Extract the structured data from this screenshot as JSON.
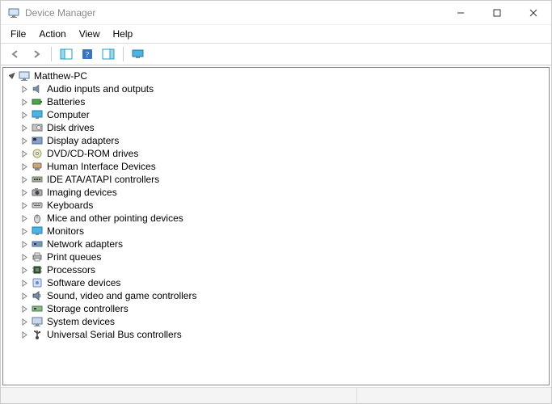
{
  "window": {
    "title": "Device Manager"
  },
  "menubar": {
    "items": [
      "File",
      "Action",
      "View",
      "Help"
    ]
  },
  "toolbar": {
    "back": "Back",
    "forward": "Forward",
    "show_hide": "Show/Hide Console Tree",
    "help": "Help",
    "action_pane": "Action Pane",
    "monitor": "Scan for hardware changes"
  },
  "tree": {
    "root": {
      "label": "Matthew-PC",
      "icon": "computer-icon",
      "expanded": true
    },
    "categories": [
      {
        "label": "Audio inputs and outputs",
        "icon": "speaker-icon"
      },
      {
        "label": "Batteries",
        "icon": "battery-icon"
      },
      {
        "label": "Computer",
        "icon": "monitor-icon"
      },
      {
        "label": "Disk drives",
        "icon": "disk-icon"
      },
      {
        "label": "Display adapters",
        "icon": "display-adapter-icon"
      },
      {
        "label": "DVD/CD-ROM drives",
        "icon": "dvd-icon"
      },
      {
        "label": "Human Interface Devices",
        "icon": "hid-icon"
      },
      {
        "label": "IDE ATA/ATAPI controllers",
        "icon": "ide-icon"
      },
      {
        "label": "Imaging devices",
        "icon": "camera-icon"
      },
      {
        "label": "Keyboards",
        "icon": "keyboard-icon"
      },
      {
        "label": "Mice and other pointing devices",
        "icon": "mouse-icon"
      },
      {
        "label": "Monitors",
        "icon": "monitor-icon"
      },
      {
        "label": "Network adapters",
        "icon": "network-icon"
      },
      {
        "label": "Print queues",
        "icon": "printer-icon"
      },
      {
        "label": "Processors",
        "icon": "cpu-icon"
      },
      {
        "label": "Software devices",
        "icon": "software-icon"
      },
      {
        "label": "Sound, video and game controllers",
        "icon": "sound-icon"
      },
      {
        "label": "Storage controllers",
        "icon": "storage-icon"
      },
      {
        "label": "System devices",
        "icon": "system-icon"
      },
      {
        "label": "Universal Serial Bus controllers",
        "icon": "usb-icon"
      }
    ]
  }
}
